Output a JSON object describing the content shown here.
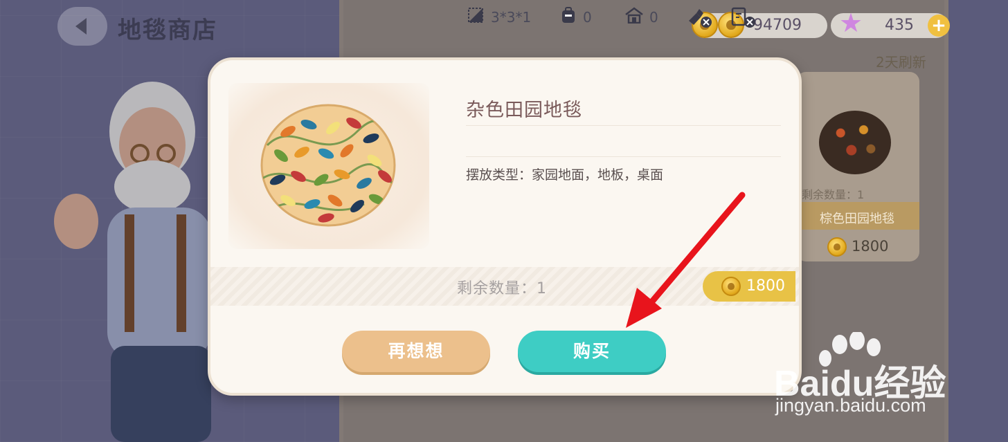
{
  "header": {
    "title": "地毯商店",
    "back_icon": "chevron-left-icon"
  },
  "currency": {
    "coins": "94709",
    "stars": "435",
    "coin_icon": "acorn-coin-icon",
    "star_icon": "purple-star-icon",
    "add_label": "+"
  },
  "shop": {
    "refresh_text": "2天刷新",
    "bg_item": {
      "remaining": "剩余数量：1",
      "name": "棕色田园地毯",
      "price": "1800"
    }
  },
  "modal": {
    "item_name": "杂色田园地毯",
    "stats": {
      "size": "3*3*1",
      "bag_count": "0",
      "home_count": "0"
    },
    "placement": "摆放类型：家园地面，地板，桌面",
    "remaining": "剩余数量：1",
    "price": "1800",
    "cancel_label": "再想想",
    "buy_label": "购买"
  },
  "watermark": {
    "brand": "Baidu经验",
    "url": "jingyan.baidu.com"
  },
  "colors": {
    "buy_button": "#3ecdc4",
    "cancel_button": "#ecc08c",
    "price_tag": "#e8c246",
    "annotation_arrow": "#e8141c"
  }
}
